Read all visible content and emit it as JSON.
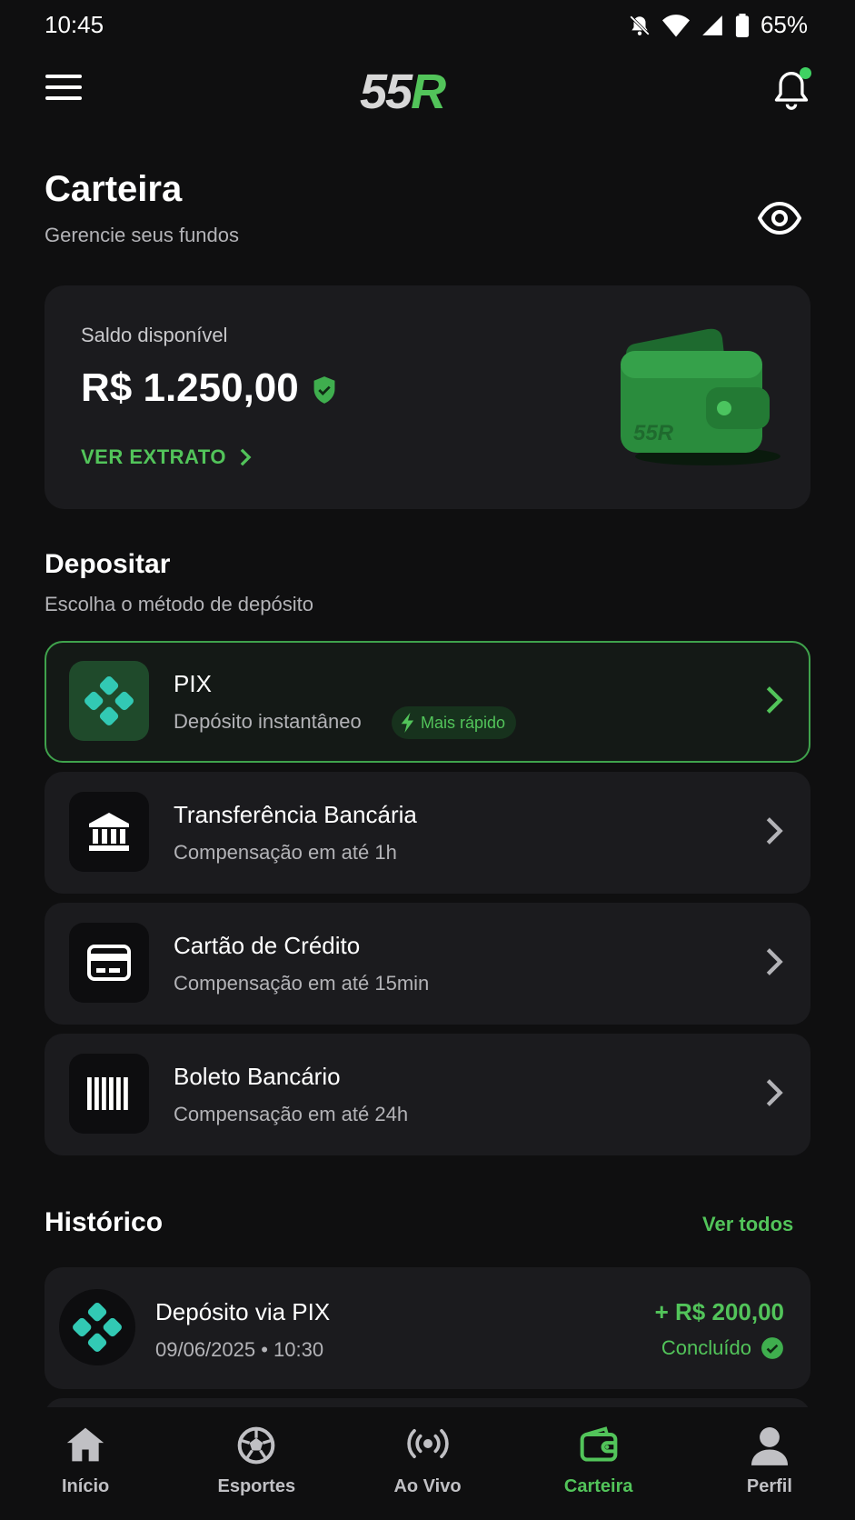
{
  "status_bar": {
    "time": "10:45",
    "battery": "65%"
  },
  "app_bar": {
    "logo_white": "55",
    "logo_green": "R"
  },
  "header": {
    "title": "Carteira",
    "subtitle": "Gerencie seus fundos"
  },
  "balance": {
    "label": "Saldo disponível",
    "value": "R$ 1.250,00",
    "extrato_label": "VER EXTRATO",
    "wallet_logo": "55R"
  },
  "deposit": {
    "title": "Depositar",
    "subtitle": "Escolha o método de depósito",
    "methods": [
      {
        "title": "PIX",
        "subtitle": "Depósito instantâneo",
        "badge": "Mais rápido",
        "icon": "pix-icon"
      },
      {
        "title": "Transferência Bancária",
        "subtitle": "Compensação em até 1h",
        "icon": "bank-icon"
      },
      {
        "title": "Cartão de Crédito",
        "subtitle": "Compensação em até 15min",
        "icon": "credit-card-icon"
      },
      {
        "title": "Boleto Bancário",
        "subtitle": "Compensação em até 24h",
        "icon": "barcode-icon"
      }
    ]
  },
  "history": {
    "title": "Histórico",
    "see_all": "Ver todos",
    "items": [
      {
        "title": "Depósito via PIX",
        "date": "09/06/2025 • 10:30",
        "amount": "+ R$ 200,00",
        "status": "Concluído"
      }
    ]
  },
  "nav": {
    "items": [
      {
        "label": "Início",
        "icon": "home-icon"
      },
      {
        "label": "Esportes",
        "icon": "soccer-ball-icon"
      },
      {
        "label": "Ao Vivo",
        "icon": "live-broadcast-icon"
      },
      {
        "label": "Carteira",
        "icon": "wallet-icon",
        "active": true
      },
      {
        "label": "Perfil",
        "icon": "user-icon"
      }
    ]
  },
  "colors": {
    "accent": "#52c45a",
    "background": "#0f0f10",
    "card": "#1b1b1e",
    "pix": "#32c9b4"
  }
}
